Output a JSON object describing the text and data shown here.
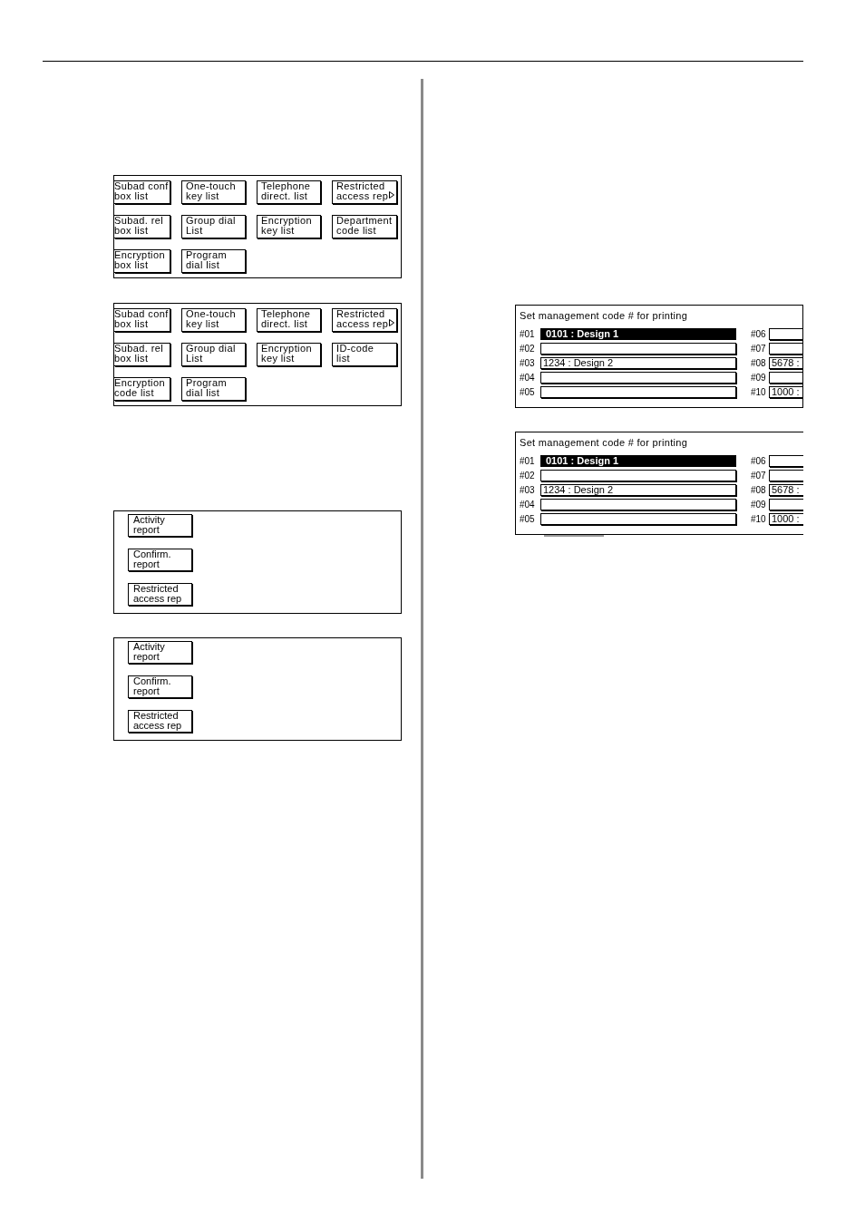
{
  "list_panels": [
    {
      "buttons": [
        {
          "lines": [
            "Subad conf",
            "box list"
          ],
          "arrow": false
        },
        {
          "lines": [
            "One-touch",
            "key list"
          ],
          "arrow": false
        },
        {
          "lines": [
            "Telephone",
            "direct. list"
          ],
          "arrow": false
        },
        {
          "lines": [
            "Restricted",
            "access rep"
          ],
          "arrow": true
        },
        {
          "lines": [
            "Subad. rel",
            "box list"
          ],
          "arrow": false
        },
        {
          "lines": [
            "Group dial",
            "List"
          ],
          "arrow": false
        },
        {
          "lines": [
            "Encryption",
            "key list"
          ],
          "arrow": false
        },
        {
          "lines": [
            "Department",
            "code list"
          ],
          "arrow": false
        },
        {
          "lines": [
            "Encryption",
            "box list"
          ],
          "arrow": false
        },
        {
          "lines": [
            "Program",
            "dial list"
          ],
          "arrow": false
        }
      ]
    },
    {
      "buttons": [
        {
          "lines": [
            "Subad conf",
            "box list"
          ],
          "arrow": false
        },
        {
          "lines": [
            "One-touch",
            "key list"
          ],
          "arrow": false
        },
        {
          "lines": [
            "Telephone",
            "direct. list"
          ],
          "arrow": false
        },
        {
          "lines": [
            "Restricted",
            "access rep"
          ],
          "arrow": true
        },
        {
          "lines": [
            "Subad. rel",
            "box list"
          ],
          "arrow": false
        },
        {
          "lines": [
            "Group dial",
            "List"
          ],
          "arrow": false
        },
        {
          "lines": [
            "Encryption",
            "key list"
          ],
          "arrow": false
        },
        {
          "lines": [
            "ID-code",
            "list"
          ],
          "arrow": false
        },
        {
          "lines": [
            "Encryption",
            "code list"
          ],
          "arrow": false
        },
        {
          "lines": [
            "Program",
            "dial list"
          ],
          "arrow": false
        }
      ]
    }
  ],
  "report_panels": [
    {
      "buttons": [
        {
          "lines": [
            "Activity",
            "report"
          ]
        },
        {
          "lines": [
            "Confirm.",
            "report"
          ]
        },
        {
          "lines": [
            "Restricted",
            "access rep"
          ]
        }
      ]
    },
    {
      "buttons": [
        {
          "lines": [
            "Activity",
            "report"
          ]
        },
        {
          "lines": [
            "Confirm.",
            "report"
          ]
        },
        {
          "lines": [
            "Restricted",
            "access rep"
          ]
        }
      ]
    }
  ],
  "code_panels": [
    {
      "title": "Set management code # for printing",
      "columns": [
        {
          "entries": [
            {
              "label": "#01",
              "value": "0101 : Design 1",
              "selected": true
            },
            {
              "label": "#02",
              "selected": false
            },
            {
              "label": "#03",
              "value": "1234 : Design 2",
              "selected": false
            },
            {
              "label": "#04",
              "selected": false
            },
            {
              "label": "#05",
              "selected": false
            }
          ]
        },
        {
          "entries": [
            {
              "label": "#06",
              "selected": false
            },
            {
              "label": "#07",
              "selected": false
            },
            {
              "label": "#08",
              "value": "5678 :",
              "selected": false
            },
            {
              "label": "#09",
              "selected": false
            },
            {
              "label": "#10",
              "value": "1000 :",
              "selected": false
            }
          ]
        }
      ]
    },
    {
      "title": "Set management code # for printing",
      "columns": [
        {
          "entries": [
            {
              "label": "#01",
              "value": "0101 : Design 1",
              "selected": true
            },
            {
              "label": "#02",
              "selected": false
            },
            {
              "label": "#03",
              "value": "1234 : Design 2",
              "selected": false
            },
            {
              "label": "#04",
              "selected": false
            },
            {
              "label": "#05",
              "selected": false
            }
          ]
        },
        {
          "entries": [
            {
              "label": "#06",
              "selected": false
            },
            {
              "label": "#07",
              "selected": false
            },
            {
              "label": "#08",
              "value": "5678 :",
              "selected": false
            },
            {
              "label": "#09",
              "selected": false
            },
            {
              "label": "#10",
              "value": "1000 :",
              "selected": false
            }
          ]
        }
      ]
    }
  ]
}
